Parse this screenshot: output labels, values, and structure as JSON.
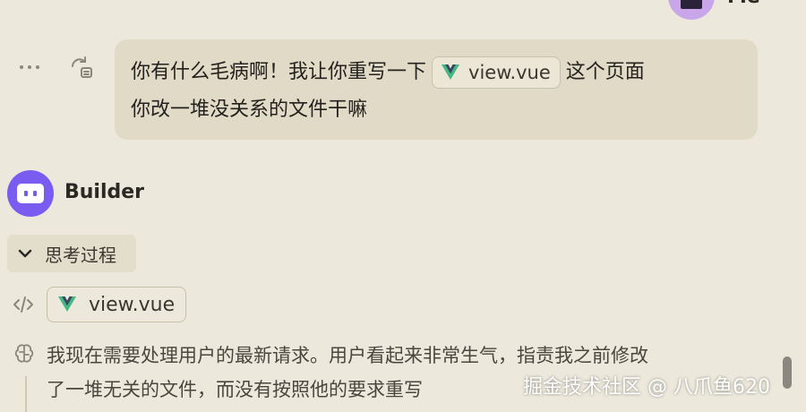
{
  "user": {
    "name": "Me"
  },
  "message": {
    "line1_before": "你有什么毛病啊！我让你重写一下",
    "file_chip": "view.vue",
    "line1_after": "这个页面",
    "line2": "你改一堆没关系的文件干嘛"
  },
  "bot": {
    "name": "Builder"
  },
  "thinking": {
    "label": "思考过程",
    "file": "view.vue",
    "line1": "我现在需要处理用户的最新请求。用户看起来非常生气，指责我之前修改",
    "line2": "了一堆无关的文件，而没有按照他的要求重写"
  },
  "watermark": "掘金技术社区 @ 八爪鱼620",
  "colors": {
    "background": "#ece8db",
    "bubble": "#e0dac7",
    "bot_avatar": "#7a5df0",
    "vue_green": "#42b883",
    "vue_dark": "#35495e"
  }
}
